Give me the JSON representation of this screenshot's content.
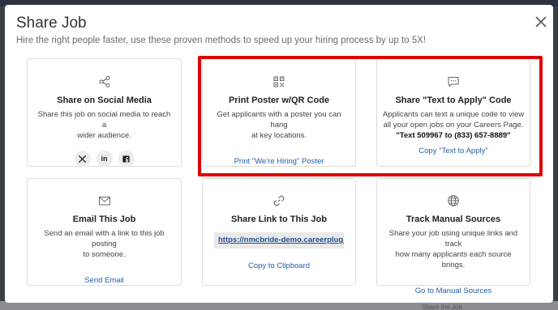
{
  "modal": {
    "title": "Share Job",
    "subtitle": "Hire the right people faster, use these proven methods to speed up your hiring process by up to 5X!"
  },
  "background": {
    "bottom_text": "Share the Job"
  },
  "cards": {
    "social": {
      "icon": "share-icon",
      "title": "Share on Social Media",
      "desc_1": "Share this job on social media to reach a",
      "desc_2": "wider audience.",
      "buttons": [
        {
          "name": "x-twitter",
          "label": "X"
        },
        {
          "name": "linkedin",
          "label": "in"
        },
        {
          "name": "facebook",
          "label": "f"
        }
      ]
    },
    "qr": {
      "icon": "qr-code-icon",
      "title": "Print Poster w/QR Code",
      "desc_1": "Get applicants with a poster you can hang",
      "desc_2": "at key locations.",
      "link": "Print \"We're Hiring\" Poster"
    },
    "text_to_apply": {
      "icon": "chat-bubble-icon",
      "title": "Share \"Text to Apply\" Code",
      "desc_1": "Applicants can text a unique code to view",
      "desc_2": "all your open jobs on your Careers Page.",
      "desc_strong": "\"Text 509967 to (833) 657-8889\"",
      "link": "Copy \"Text to Apply\""
    },
    "email": {
      "icon": "envelope-icon",
      "title": "Email This Job",
      "desc_1": "Send an email with a link to this job posting",
      "desc_2": "to someone.",
      "link": "Send Email"
    },
    "share_link": {
      "icon": "link-icon",
      "title": "Share Link to This Job",
      "url": "https://nmcbride-demo.careerplug.com/jo",
      "link": "Copy to Clipboard"
    },
    "manual_sources": {
      "icon": "globe-icon",
      "title": "Track Manual Sources",
      "desc_1": "Share your job using unique links and track",
      "desc_2": "how many applicants each source brings.",
      "link": "Go to Manual Sources"
    }
  },
  "colors": {
    "highlight": "#dd0000",
    "link": "#1f5fa8",
    "card_border": "#dcdcdc"
  }
}
